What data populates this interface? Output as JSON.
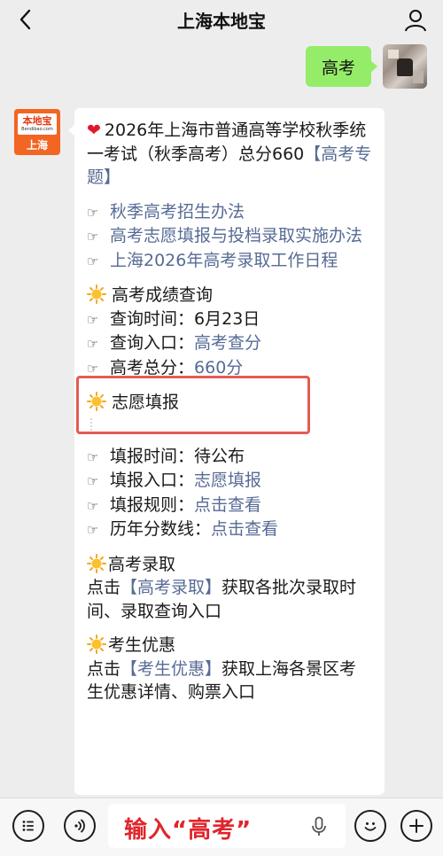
{
  "header": {
    "title": "上海本地宝",
    "back_icon": "chevron-left-icon",
    "profile_icon": "user-icon"
  },
  "outgoing": {
    "text": "高考"
  },
  "account_avatar": {
    "logo_name": "本地宝",
    "logo_domain": "Bendibao.com",
    "city": "上海"
  },
  "message": {
    "intro_prefix": "2026年上海市普通高等学校秋季统一考试（秋季高考）总分660",
    "intro_link": "【高考专题】",
    "links": [
      {
        "hand": "☞",
        "text": "秋季高考招生办法"
      },
      {
        "hand": "☞",
        "text": "高考志愿填报与投档录取实施办法"
      },
      {
        "hand": "☞",
        "text": "上海2026年高考录取工作日程"
      }
    ],
    "score_section": {
      "heading": "高考成绩查询",
      "time_label": "查询时间：",
      "time_value": "6月23日",
      "entry_label": "查询入口：",
      "entry_value": "高考查分",
      "total_label": "高考总分：",
      "total_value": "660分"
    },
    "volunteer_section": {
      "heading": "志愿填报",
      "rows": [
        {
          "label": "填报时间：",
          "value": "待公布",
          "is_link": false
        },
        {
          "label": "填报入口：",
          "value": "志愿填报",
          "is_link": true
        },
        {
          "label": "填报规则：",
          "value": "点击查看",
          "is_link": true
        },
        {
          "label": "历年分数线：",
          "value": "点击查看",
          "is_link": true
        }
      ]
    },
    "admission_section": {
      "heading": "高考录取",
      "prefix": "点击",
      "link": "【高考录取】",
      "suffix": "获取各批次录取时间、录取查询入口"
    },
    "discount_section": {
      "heading": "考生优惠",
      "prefix": "点击",
      "link": "【考生优惠】",
      "suffix": "获取上海各景区考生优惠详情、购票入口"
    }
  },
  "input_bar": {
    "text": "输入“高考”",
    "left_icons": [
      "menu-list-icon",
      "voice-wave-icon"
    ],
    "right_icons": [
      "emoji-icon",
      "plus-icon"
    ],
    "mic_icon": "microphone-icon"
  },
  "colors": {
    "link": "#576b95",
    "bubble_out": "#95ec69",
    "highlight": "#e35b54",
    "brand_orange": "#f26522"
  }
}
